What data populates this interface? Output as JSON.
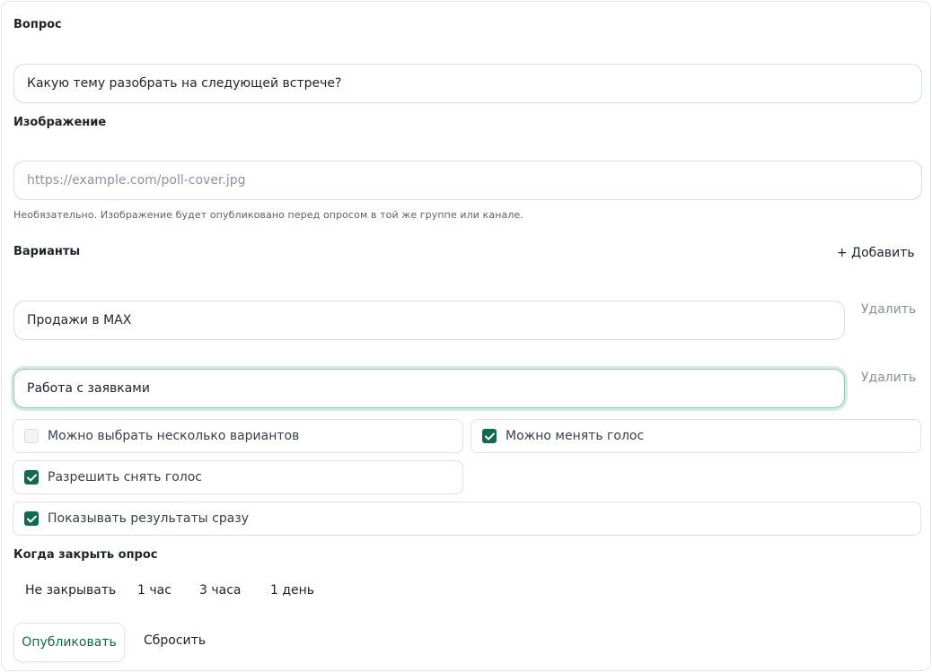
{
  "question": {
    "label": "Вопрос",
    "value": "Какую тему разобрать на следующей встрече?"
  },
  "image": {
    "label": "Изображение",
    "placeholder": "https://example.com/poll-cover.jpg",
    "hint": "Необязательно. Изображение будет опубликовано перед опросом в той же группе или канале."
  },
  "options": {
    "label": "Варианты",
    "add_label": "+ Добавить",
    "items": [
      {
        "value": "Продажи в MAX",
        "delete_label": "Удалить"
      },
      {
        "value": "Работа с заявками",
        "delete_label": "Удалить"
      }
    ]
  },
  "settings": {
    "multiple_choice": {
      "label": "Можно выбрать несколько вариантов",
      "checked": false
    },
    "change_vote": {
      "label": "Можно менять голос",
      "checked": true
    },
    "retract_vote": {
      "label": "Разрешить снять голос",
      "checked": true
    },
    "show_results": {
      "label": "Показывать результаты сразу",
      "checked": true
    }
  },
  "close": {
    "label": "Когда закрыть опрос",
    "choices": [
      "Не закрывать",
      "1 час",
      "3 часа",
      "1 день"
    ]
  },
  "actions": {
    "publish_label": "Опубликовать",
    "reset_label": "Сбросить"
  },
  "colors": {
    "accent": "#0f6b4d",
    "focus_ring": "#d5ebe3"
  },
  "icons": {
    "checkmark": "check-icon"
  }
}
